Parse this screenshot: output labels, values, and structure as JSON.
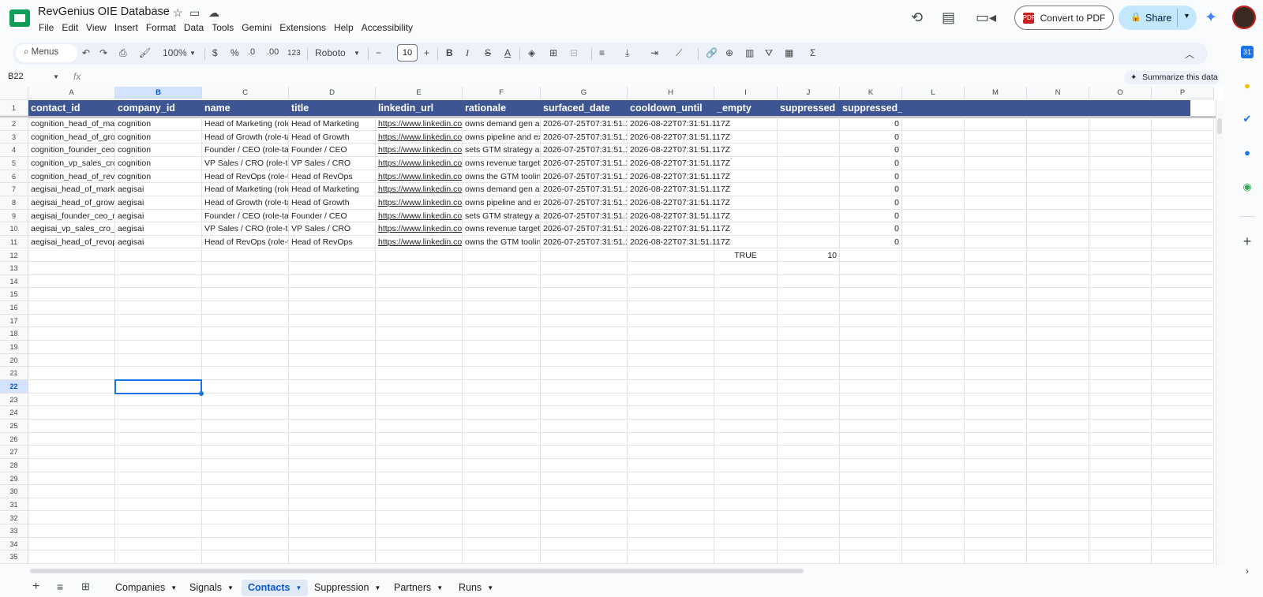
{
  "title_bar": {
    "doc_title": "RevGenius OIE Database",
    "menu": [
      "File",
      "Edit",
      "View",
      "Insert",
      "Format",
      "Data",
      "Tools",
      "Gemini",
      "Extensions",
      "Help",
      "Accessibility"
    ],
    "convert_label": "Convert to PDF",
    "share_label": "Share",
    "pdf_badge": "PDF"
  },
  "toolbar": {
    "menus_label": "Menus",
    "zoom": "100%",
    "currency": "$",
    "percent": "%",
    "dec_less": ".0",
    "dec_more": ".00",
    "number_format": "123",
    "font": "Roboto",
    "font_size": "10",
    "bold": "B",
    "italic": "I",
    "strike": "S",
    "text_color": "A"
  },
  "formula_bar": {
    "name_box": "B22",
    "fx": "fx",
    "summarize_label": "Summarize this data"
  },
  "grid": {
    "col_letters": [
      "A",
      "B",
      "C",
      "D",
      "E",
      "F",
      "G",
      "H",
      "I",
      "J",
      "K",
      "L",
      "M",
      "N",
      "O",
      "P"
    ],
    "headers": [
      "contact_id",
      "company_id",
      "name",
      "title",
      "linkedin_url",
      "rationale",
      "surfaced_date",
      "cooldown_until",
      "_empty",
      "suppressed",
      "suppressed_last_run"
    ],
    "rows": [
      [
        "cognition_head_of_mar",
        "cognition",
        "Head of Marketing (role",
        "Head of Marketing",
        "https://www.linkedin.co",
        "owns demand gen ar",
        "2026-07-25T07:31:51.1",
        "2026-08-22T07:31:51.117Z",
        "",
        "",
        "0"
      ],
      [
        "cognition_head_of_gro",
        "cognition",
        "Head of Growth (role-ta",
        "Head of Growth",
        "https://www.linkedin.co",
        "owns pipeline and ex",
        "2026-07-25T07:31:51.1",
        "2026-08-22T07:31:51.117Z",
        "",
        "",
        "0"
      ],
      [
        "cognition_founder_ceo",
        "cognition",
        "Founder / CEO (role-tar",
        "Founder / CEO",
        "https://www.linkedin.co",
        "sets GTM strategy at",
        "2026-07-25T07:31:51.1",
        "2026-08-22T07:31:51.117Z",
        "",
        "",
        "0"
      ],
      [
        "cognition_vp_sales_cro",
        "cognition",
        "VP Sales / CRO (role-ta",
        "VP Sales / CRO",
        "https://www.linkedin.co",
        "owns revenue targets",
        "2026-07-25T07:31:51.1",
        "2026-08-22T07:31:51.117Z",
        "",
        "",
        "0"
      ],
      [
        "cognition_head_of_reve",
        "cognition",
        "Head of RevOps (role-ta",
        "Head of RevOps",
        "https://www.linkedin.co",
        "owns the GTM toolin",
        "2026-07-25T07:31:51.1",
        "2026-08-22T07:31:51.117Z",
        "",
        "",
        "0"
      ],
      [
        "aegisai_head_of_marke",
        "aegisai",
        "Head of Marketing (role",
        "Head of Marketing",
        "https://www.linkedin.co",
        "owns demand gen ar",
        "2026-07-25T07:31:51.1",
        "2026-08-22T07:31:51.117Z",
        "",
        "",
        "0"
      ],
      [
        "aegisai_head_of_growt",
        "aegisai",
        "Head of Growth (role-ta",
        "Head of Growth",
        "https://www.linkedin.co",
        "owns pipeline and ex",
        "2026-07-25T07:31:51.1",
        "2026-08-22T07:31:51.117Z",
        "",
        "",
        "0"
      ],
      [
        "aegisai_founder_ceo_r",
        "aegisai",
        "Founder / CEO (role-tar",
        "Founder / CEO",
        "https://www.linkedin.co",
        "sets GTM strategy at",
        "2026-07-25T07:31:51.1",
        "2026-08-22T07:31:51.117Z",
        "",
        "",
        "0"
      ],
      [
        "aegisai_vp_sales_cro_r",
        "aegisai",
        "VP Sales / CRO (role-ta",
        "VP Sales / CRO",
        "https://www.linkedin.co",
        "owns revenue targets",
        "2026-07-25T07:31:51.1",
        "2026-08-22T07:31:51.117Z",
        "",
        "",
        "0"
      ],
      [
        "aegisai_head_of_revops",
        "aegisai",
        "Head of RevOps (role-ta",
        "Head of RevOps",
        "https://www.linkedin.co",
        "owns the GTM toolin",
        "2026-07-25T07:31:51.1",
        "2026-08-22T07:31:51.117Z",
        "",
        "",
        "0"
      ],
      [
        "",
        "",
        "",
        "",
        "",
        "",
        "",
        "",
        "TRUE",
        "10",
        ""
      ]
    ],
    "row_count": 35,
    "selected_col": "B",
    "selected_row": "22"
  },
  "sheet_tabs": [
    "Companies",
    "Signals",
    "Contacts",
    "Suppression",
    "Partners",
    "Runs"
  ],
  "active_tab": "Contacts",
  "colors": {
    "header_fill": "#3e5593",
    "selection": "#1a73e8",
    "share_bg": "#c2e7ff"
  }
}
